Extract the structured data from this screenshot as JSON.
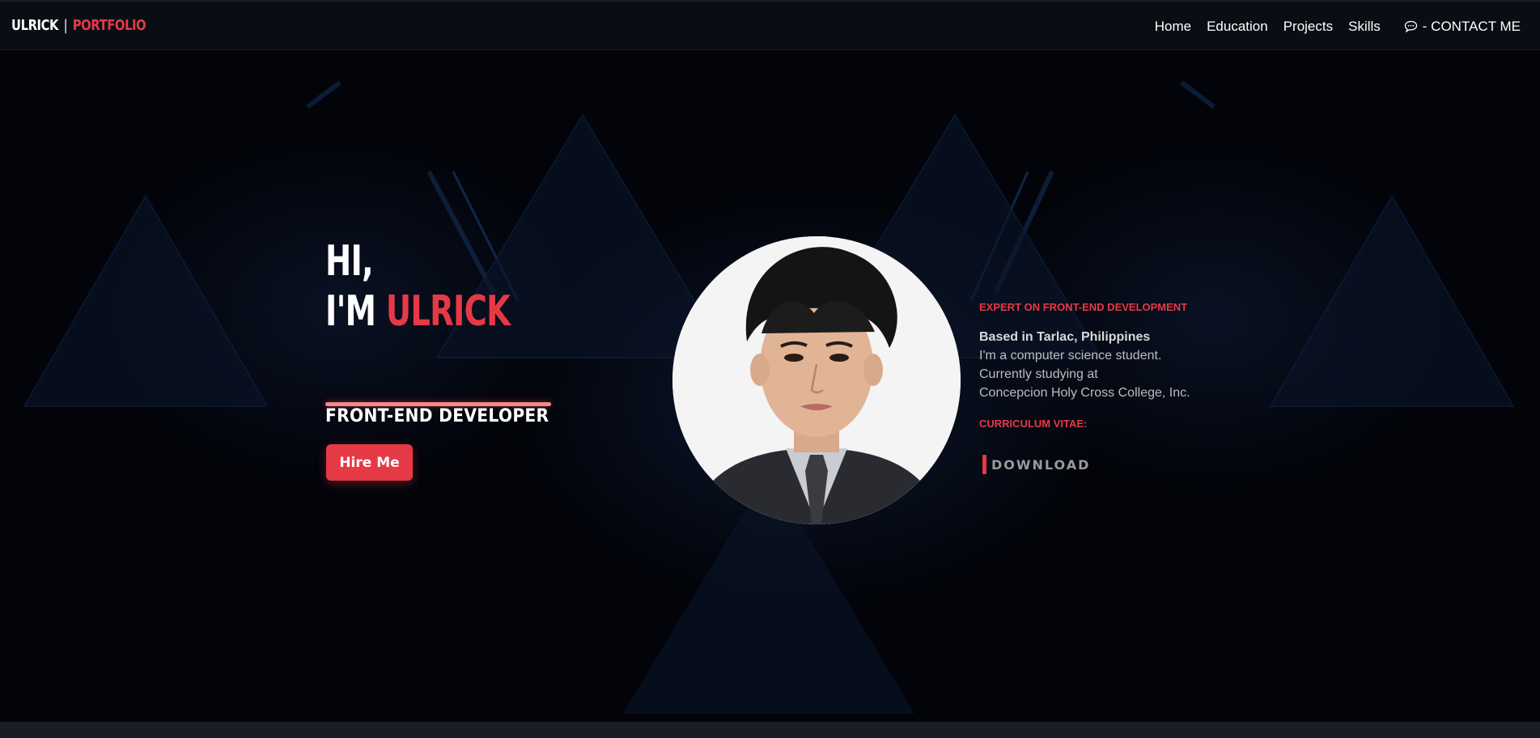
{
  "header": {
    "logo_first": "ULRICK",
    "logo_separator": "|",
    "logo_second": "PORTFOLIO",
    "nav": [
      "Home",
      "Education",
      "Projects",
      "Skills"
    ],
    "contact_label": "- CONTACT ME",
    "contact_icon": "chat-bubble-icon"
  },
  "hero": {
    "greeting_line1": "HI,",
    "greeting_line2_prefix": "I'M ",
    "greeting_name": "ULRICK",
    "role": "FRONT-END DEVELOPER",
    "hire_button": "Hire Me"
  },
  "info": {
    "expert": "EXPERT ON FRONT-END DEVELOPMENT",
    "based": "Based in Tarlac, Philippines",
    "lines": [
      "I'm a computer science student.",
      "Currently studying at",
      "Concepcion Holy Cross College, Inc."
    ],
    "cv_label": "CURRICULUM VITAE:",
    "download": "DOWNLOAD"
  },
  "colors": {
    "accent": "#e63946",
    "background": "#02040a",
    "header_bg": "#0b0d14"
  }
}
